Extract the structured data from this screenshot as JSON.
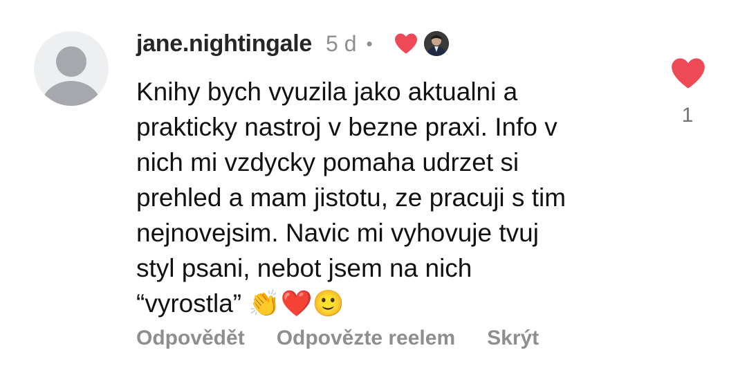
{
  "comment": {
    "username": "jane.nightingale",
    "time": "5 d",
    "separator": "•",
    "text": "Knihy bych vyuzila jako aktualni a\nprakticky nastroj v bezne praxi. Info v\nnich mi vzdycky pomaha udrzet si\nprehled a mam jistotu, ze pracuji s tim\nnejnovejsim. Navic mi vyhovuje tvuj\nstyl psani, nebot jsem na nich\n“vyrostla” 👏❤️🙂",
    "like_count": "1",
    "liked_by_creator": true,
    "liked": true
  },
  "actions": {
    "reply_label": "Odpovědět",
    "reel_reply_label": "Odpovězte reelem",
    "hide_label": "Skrýt"
  },
  "colors": {
    "heart": "#ed4956",
    "secondary_text": "#8e8e8e",
    "avatar_bg": "#eeeff1",
    "avatar_fg": "#a7a8ad"
  },
  "icons": {
    "avatar": "default-avatar-icon",
    "creator_heart": "heart-filled-icon",
    "like": "heart-filled-icon"
  }
}
